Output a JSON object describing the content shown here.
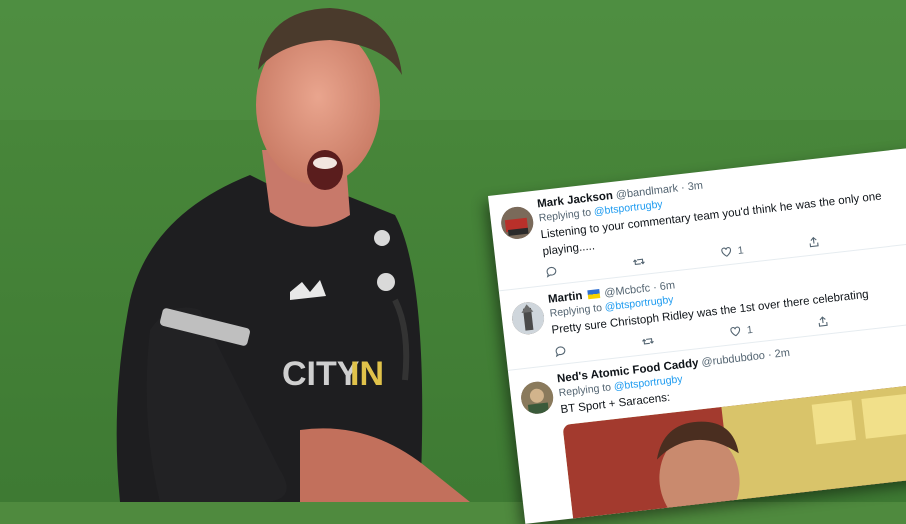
{
  "tweets": [
    {
      "name": "Mark Jackson",
      "handle": "@bandlmark",
      "time": "· 3m",
      "replying_prefix": "Replying to",
      "replying_handle": "@btsportrugby",
      "text": "Listening to your commentary team you'd think he was the only one playing.....",
      "likes": "1"
    },
    {
      "name": "Martin",
      "flag": true,
      "handle": "@Mcbcfc",
      "time": "· 6m",
      "replying_prefix": "Replying to",
      "replying_handle": "@btsportrugby",
      "text": "Pretty sure Christoph Ridley was the 1st over there celebrating",
      "likes": "1"
    },
    {
      "name": "Ned's Atomic Food Caddy",
      "handle": "@rubdubdoo",
      "time": "· 2m",
      "replying_prefix": "Replying to",
      "replying_handle": "@btsportrugby",
      "text": "BT Sport + Saracens:"
    }
  ],
  "icons": [
    "reply-icon",
    "retweet-icon",
    "like-icon",
    "share-icon"
  ],
  "colors": {
    "pitch": "#4f8a3e",
    "link": "#1d9bf0",
    "jersey": "#1c1c1e"
  }
}
